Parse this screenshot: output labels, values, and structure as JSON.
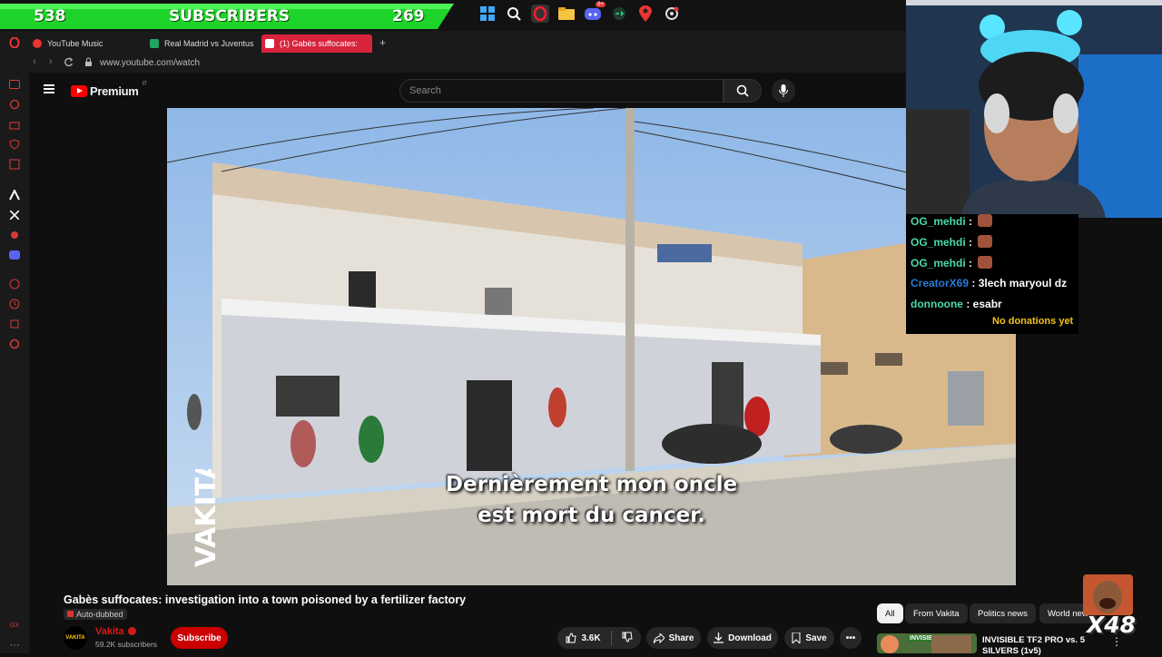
{
  "sub_banner": {
    "left_count": "538",
    "label": "SUBSCRIBERS",
    "right_count": "269",
    "color": "#1ed42a"
  },
  "taskbar": {
    "icons": [
      "windows-icon",
      "search-icon",
      "opera-icon",
      "folder-icon",
      "discord-icon",
      "terminal-icon",
      "pin-icon",
      "gear-icon"
    ],
    "discord_badge": "9+"
  },
  "browser": {
    "tabs": [
      {
        "label": "YouTube Music",
        "icon": "youtube-music-icon"
      },
      {
        "label": "Real Madrid vs Juventus",
        "icon": "sheet-icon"
      },
      {
        "label": "(1) Gabès suffocates:",
        "icon": "youtube-icon"
      }
    ],
    "new_tab": "+",
    "url": "www.youtube.com/watch"
  },
  "youtube": {
    "brand": "Premium",
    "region": "IT",
    "search_placeholder": "Search"
  },
  "video": {
    "caption_line1": "Dernièrement mon oncle",
    "caption_line2": "est mort du cancer.",
    "watermark": "VAKITA"
  },
  "chat": {
    "messages": [
      {
        "user": "OG_mehdi",
        "sep": ":",
        "msg": "",
        "emote": true
      },
      {
        "user": "OG_mehdi",
        "sep": ":",
        "msg": "",
        "emote": true
      },
      {
        "user": "OG_mehdi",
        "sep": ":",
        "msg": "",
        "emote": true
      },
      {
        "user": "CreatorX69",
        "sep": ":",
        "msg": "3lech maryoul dz",
        "emote": false
      },
      {
        "user": "donnoone",
        "sep": ":",
        "msg": "esabr",
        "emote": false
      }
    ],
    "donations": "No donations yet"
  },
  "info": {
    "title": "Gabès suffocates: investigation into a town poisoned by a fertilizer factory",
    "auto_dubbed": "Auto-dubbed",
    "channel": "Vakita",
    "channel_avatar_text": "VAKITA",
    "subscribers": "59.2K subscribers",
    "subscribe": "Subscribe",
    "likes": "3.6K",
    "share": "Share",
    "download": "Download",
    "save": "Save"
  },
  "chips": [
    "All",
    "From Vakita",
    "Politics news",
    "World new"
  ],
  "recommended": {
    "title": "INVISIBLE TF2 PRO vs. 5 SILVERS (1v5)",
    "thumb_text": "INVISIBLE"
  },
  "emote_overlay": {
    "multiplier": "X48"
  }
}
